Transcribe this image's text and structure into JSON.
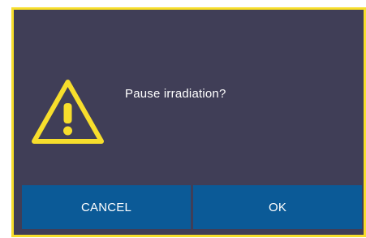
{
  "dialog": {
    "message": "Pause irradiation?",
    "icon": "warning-icon",
    "cancel_label": "CANCEL",
    "ok_label": "OK"
  },
  "colors": {
    "background": "#403e57",
    "border": "#f7de2c",
    "button": "#0b5a97",
    "text": "#ffffff"
  }
}
